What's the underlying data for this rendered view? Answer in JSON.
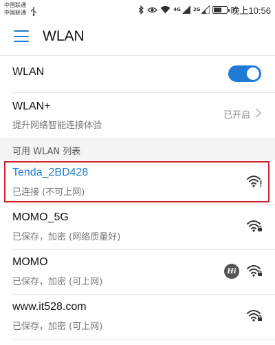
{
  "status_bar": {
    "carrier_1": "中国联通",
    "carrier_2": "中国联通",
    "net_label_1": "4G",
    "net_label_2": "2G",
    "time": "晚上10:56",
    "battery_level": 0.6,
    "icons": [
      "usb-icon",
      "bluetooth-icon",
      "eye-icon",
      "wifi-status-icon",
      "signal-icon",
      "battery-icon"
    ]
  },
  "app_bar": {
    "title": "WLAN",
    "menu_icon": "menu-icon",
    "accent_color": "#1f7bd6"
  },
  "wlan_toggle": {
    "label": "WLAN",
    "on": true
  },
  "wlan_plus": {
    "title": "WLAN+",
    "subtitle": "提升网络智能连接体验",
    "status": "已开启"
  },
  "section_header": "可用 WLAN 列表",
  "networks": [
    {
      "name": "Tenda_2BD428",
      "status": "已连接 (不可上网)",
      "connected": true,
      "locked": false,
      "warning": true,
      "highlighted": true
    },
    {
      "name": "MOMO_5G",
      "status": "已保存，加密 (网络质量好)",
      "connected": false,
      "locked": true,
      "warning": false
    },
    {
      "name": "MOMO",
      "status": "已保存，加密 (可上网)",
      "connected": false,
      "locked": true,
      "warning": false,
      "badge": "Hi"
    },
    {
      "name": "www.it528.com",
      "status": "已保存，加密 (可上网)",
      "connected": false,
      "locked": true,
      "warning": false
    }
  ],
  "highlight_color": "#d0212a"
}
